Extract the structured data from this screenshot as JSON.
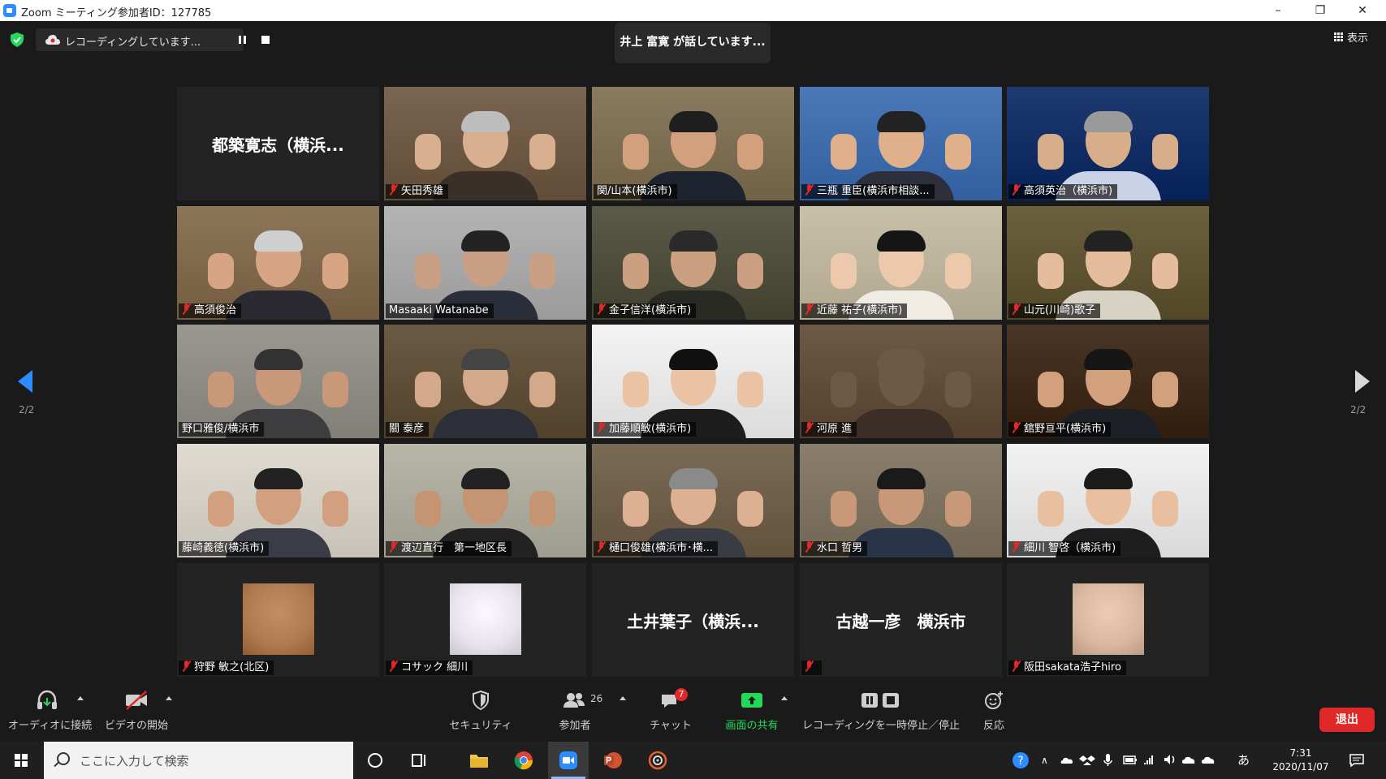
{
  "window": {
    "title": "Zoom ミーティング参加者ID：127785",
    "minimize": "–",
    "restore": "❐",
    "close": "✕"
  },
  "top": {
    "recording_text": "レコーディングしています...",
    "speaker_text": "井上 富寛 が話しています...",
    "view_label": "表示"
  },
  "pager": {
    "left": "2/2",
    "right": "2/2"
  },
  "tiles": [
    {
      "kind": "name",
      "name": "都築寛志（横浜...",
      "muted": false
    },
    {
      "kind": "video",
      "name": "矢田秀雄",
      "muted": true,
      "bg": "#7a6650",
      "suit": "#3a3028",
      "skin": "#d9b08f",
      "hair": "#bdbdbd"
    },
    {
      "kind": "video",
      "name": "関/山本(横浜市)",
      "muted": false,
      "bg": "#8a7a60",
      "suit": "#1e2330",
      "skin": "#d2a07c",
      "hair": "#1e1e1e"
    },
    {
      "kind": "video",
      "name": "三瓶 重臣(横浜市相談...",
      "muted": true,
      "bg": "#4b78b8",
      "suit": "#2d2f3a",
      "skin": "#e0b08a",
      "hair": "#222"
    },
    {
      "kind": "video",
      "name": "高須英治（横浜市)",
      "muted": true,
      "bg": "#1e3a70",
      "suit": "#c9d2e6",
      "skin": "#d8ae8a",
      "hair": "#9a9a9a"
    },
    {
      "kind": "video",
      "name": "高須俊治",
      "muted": true,
      "bg": "#8d7559",
      "suit": "#2b2a30",
      "skin": "#d7a583",
      "hair": "#cfcfcf"
    },
    {
      "kind": "video",
      "name": "Masaaki Watanabe",
      "muted": false,
      "bg": "#b4b4b4",
      "suit": "#2a2e3a",
      "skin": "#c9a086",
      "hair": "#222"
    },
    {
      "kind": "video",
      "name": "金子信洋(横浜市)",
      "muted": true,
      "bg": "#5b5a48",
      "suit": "#2a2a24",
      "skin": "#caa080",
      "hair": "#2a2a2a"
    },
    {
      "kind": "video",
      "name": "近藤 祐子(横浜市)",
      "muted": true,
      "bg": "#c8c0a8",
      "suit": "#f0ece4",
      "skin": "#ecc9ad",
      "hair": "#151515"
    },
    {
      "kind": "video",
      "name": "山元(川崎)歌子",
      "muted": true,
      "bg": "#6b6040",
      "suit": "#d9d3c6",
      "skin": "#e6bd9c",
      "hair": "#222"
    },
    {
      "kind": "video",
      "name": "野口雅俊/横浜市",
      "muted": false,
      "bg": "#9a9890",
      "suit": "#3d3d40",
      "skin": "#c99878",
      "hair": "#333"
    },
    {
      "kind": "video",
      "name": "關 泰彦",
      "muted": false,
      "bg": "#6b5a44",
      "suit": "#2d2f38",
      "skin": "#d4a88a",
      "hair": "#444"
    },
    {
      "kind": "video",
      "name": "加藤順敏(横浜市)",
      "muted": true,
      "bg": "#f4f4f4",
      "suit": "#1d1d1d",
      "skin": "#e9c3a4",
      "hair": "#111"
    },
    {
      "kind": "video",
      "name": "河原 進",
      "muted": true,
      "bg": "#6e5846",
      "suit": "#3a2e26",
      "skin": "#6e5846",
      "hair": "#6e5846"
    },
    {
      "kind": "video",
      "name": "舘野亘平(横浜市)",
      "muted": true,
      "bg": "#4a3626",
      "suit": "#1e2028",
      "skin": "#d3a07e",
      "hair": "#161616"
    },
    {
      "kind": "video",
      "name": "藤崎義徳(横浜市)",
      "muted": false,
      "bg": "#e0dbd0",
      "suit": "#3a3c48",
      "skin": "#d2a07e",
      "hair": "#222"
    },
    {
      "kind": "video",
      "name": "渡辺直行　第一地区長",
      "muted": true,
      "bg": "#b8b6a8",
      "suit": "#222",
      "skin": "#c49473",
      "hair": "#222"
    },
    {
      "kind": "video",
      "name": "樋口俊雄(横浜市･横...",
      "muted": true,
      "bg": "#7a6a56",
      "suit": "#3a3c44",
      "skin": "#dcb090",
      "hair": "#8a8a8a"
    },
    {
      "kind": "video",
      "name": "水口 哲男",
      "muted": true,
      "bg": "#8a7e6c",
      "suit": "#2a3448",
      "skin": "#c89878",
      "hair": "#1a1a1a"
    },
    {
      "kind": "video",
      "name": "細川 智啓（横浜市)",
      "muted": true,
      "bg": "#f2f2f2",
      "suit": "#1e1e1e",
      "skin": "#e8c0a0",
      "hair": "#1a1a1a"
    },
    {
      "kind": "avatar",
      "name": "狩野 敏之(北区)",
      "muted": true,
      "av": "#b07a50"
    },
    {
      "kind": "avatar",
      "name": "コサック 細川",
      "muted": true,
      "av": "#e8e4ec"
    },
    {
      "kind": "name",
      "name": "土井葉子（横浜...",
      "muted": false
    },
    {
      "kind": "name",
      "name": "古越一彦　横浜市",
      "muted": true,
      "tagname": ""
    },
    {
      "kind": "avatar",
      "name": "阪田sakata浩子hiro",
      "muted": true,
      "av": "#d9b7a0"
    }
  ],
  "toolbar": {
    "audio": "オーディオに接続",
    "video": "ビデオの開始",
    "security": "セキュリティ",
    "participants": "参加者",
    "participants_count": "26",
    "chat": "チャット",
    "chat_badge": "7",
    "share": "画面の共有",
    "recording": "レコーディングを一時停止／停止",
    "reactions": "反応",
    "leave": "退出"
  },
  "taskbar": {
    "search_placeholder": "ここに入力して検索",
    "time": "7:31",
    "date": "2020/11/07",
    "ime": "あ"
  },
  "colors": {
    "accent": "#2d8cff",
    "mute": "#e02828",
    "share": "#23d959",
    "leave": "#e02828"
  }
}
